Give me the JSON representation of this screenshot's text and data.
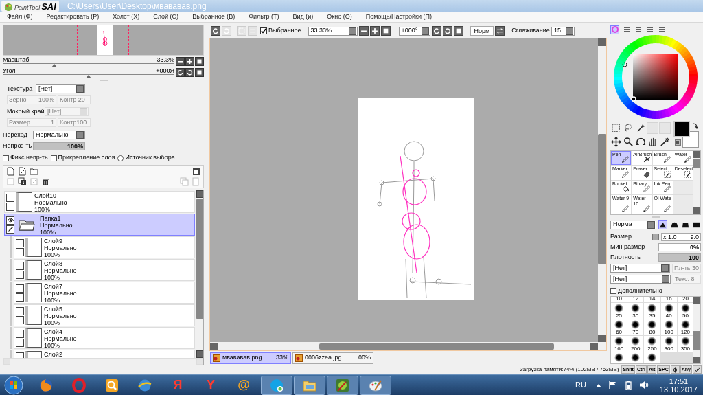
{
  "title_bar": {
    "logo_text": "PaintTool",
    "logo_mark": "SAI",
    "file_path": "C:\\Users\\User\\Desktop\\мвававав.png"
  },
  "menu": [
    "Файл (Ф)",
    "Редактировать (Р)",
    "Холст (Х)",
    "Слой (С)",
    "Выбранное (В)",
    "Фильтр (Т)",
    "Вид (и)",
    "Окно (О)",
    "Помощь/Настройки (П)"
  ],
  "navigator": {
    "zoom": {
      "label": "Масштаб",
      "value": "33.3%",
      "level": 0.3
    },
    "angle": {
      "label": "Угол",
      "value": "+000Я",
      "level": 0.5
    }
  },
  "texture": {
    "label": "Текстура",
    "value": "[Нет]",
    "grain": {
      "label": "Зерно",
      "value": "100%",
      "disabled": true
    },
    "contrast": {
      "value": "Контр 20",
      "disabled": true
    }
  },
  "wet_edge": {
    "label": "Мокрый край",
    "value": "[Нет]",
    "disabled": true,
    "size": {
      "label": "Размер",
      "value": "1",
      "disabled": true
    },
    "contrast": {
      "value": "Контр100",
      "disabled": true
    }
  },
  "blending": {
    "label": "Переход",
    "value": "Нормально"
  },
  "opacity": {
    "label": "Непроз-ть",
    "value": "100%",
    "level": 1
  },
  "layer_options": [
    {
      "kind": "checkbox",
      "label": "Фикс непр-ть",
      "checked": false
    },
    {
      "kind": "checkbox",
      "label": "Прикрепление слоя",
      "checked": false
    },
    {
      "kind": "radio",
      "label": "Источник выбора",
      "checked": false
    }
  ],
  "layers": [
    {
      "kind": "layer",
      "name": "Слой10",
      "mode": "Нормально",
      "opacity": "100%",
      "selected": false,
      "visible": false
    },
    {
      "kind": "folder",
      "name": "Папка1",
      "mode": "Нормально",
      "opacity": "100%",
      "selected": true,
      "visible": true,
      "children": [
        {
          "kind": "layer",
          "name": "Слой9",
          "mode": "Нормально",
          "opacity": "100%",
          "selected": false,
          "visible": false
        },
        {
          "kind": "layer",
          "name": "Слой8",
          "mode": "Нормально",
          "opacity": "100%",
          "selected": false,
          "visible": false
        },
        {
          "kind": "layer",
          "name": "Слой7",
          "mode": "Нормально",
          "opacity": "100%",
          "selected": false,
          "visible": false
        },
        {
          "kind": "layer",
          "name": "Слой5",
          "mode": "Нормально",
          "opacity": "100%",
          "selected": false,
          "visible": false
        },
        {
          "kind": "layer",
          "name": "Слой4",
          "mode": "Нормально",
          "opacity": "100%",
          "selected": false,
          "visible": false
        },
        {
          "kind": "layer",
          "name": "Слой2",
          "selected": false,
          "visible": false
        }
      ]
    }
  ],
  "canvas_toolbar": {
    "selection_only": {
      "label": "Выбранное",
      "checked": true
    },
    "zoom": "33.33%",
    "angle": "+000°",
    "mode_button": "Норм",
    "smoothing": {
      "label": "Сглаживание",
      "value": "15"
    }
  },
  "documents": [
    {
      "name": "мвававав.png",
      "zoom": "33%",
      "selected": true
    },
    {
      "name": "0006zzea.jpg",
      "zoom": "00%",
      "selected": false
    }
  ],
  "status_bar": {
    "memory": "Загрузка памяти:74% (102MB / 763MB)",
    "keys": [
      {
        "kind": "text",
        "label": "Shift"
      },
      {
        "kind": "text",
        "label": "Ctrl"
      },
      {
        "kind": "text",
        "label": "Alt"
      },
      {
        "kind": "text",
        "label": "SPC"
      },
      {
        "kind": "move"
      },
      {
        "kind": "text",
        "label": "Any"
      },
      {
        "kind": "pen"
      }
    ]
  },
  "color_tabs": [
    {
      "kind": "wheel",
      "selected": true
    },
    {
      "kind": "sliders",
      "selected": false
    },
    {
      "kind": "sliders",
      "selected": false
    },
    {
      "kind": "sliders",
      "selected": false
    },
    {
      "kind": "sliders",
      "selected": false
    }
  ],
  "swatches": [
    {
      "kind": "primary",
      "color": "#000000"
    },
    {
      "kind": "secondary",
      "color": "#ffffff"
    }
  ],
  "brush_tools": [
    {
      "kind": "pen",
      "label": "Pen",
      "selected": true
    },
    {
      "kind": "airbrush",
      "label": "AirBrush",
      "selected": false
    },
    {
      "kind": "pen",
      "label": "Brush",
      "selected": false
    },
    {
      "kind": "pen",
      "label": "Water",
      "selected": false
    },
    {
      "kind": "pen",
      "label": "Marker",
      "selected": false
    },
    {
      "kind": "eraser",
      "label": "Eraser",
      "selected": false
    },
    {
      "kind": "select",
      "label": "Select",
      "selected": false
    },
    {
      "kind": "select",
      "label": "Deselect",
      "selected": false
    },
    {
      "kind": "bucket",
      "label": "Bucket",
      "selected": false
    },
    {
      "kind": "pencil",
      "label": "Binary",
      "selected": false
    },
    {
      "kind": "pen",
      "label": "Ink Pen",
      "selected": false
    },
    {
      "kind": "empty"
    },
    {
      "kind": "pen",
      "label": "Water 9",
      "selected": false
    },
    {
      "kind": "pen",
      "label": "Water 10",
      "selected": false
    },
    {
      "kind": "pen",
      "label": "Ol Wate",
      "selected": false
    },
    {
      "kind": "empty"
    }
  ],
  "brush_settings": {
    "mode": "Норма",
    "shapes": [
      {
        "kind": "sharp",
        "selected": true
      },
      {
        "kind": "round",
        "selected": false
      },
      {
        "kind": "flat",
        "selected": false
      },
      {
        "kind": "square",
        "selected": false
      }
    ],
    "size": {
      "label": "Размер",
      "multiplier": "x 1.0",
      "value": "9.0"
    },
    "min_size": {
      "label": "Мин размер",
      "value": "0%",
      "level": 0
    },
    "density": {
      "label": "Плотность",
      "value": "100",
      "level": 1
    },
    "materials": [
      {
        "value": "[Нет]",
        "param": "Пл-ть 30",
        "disabled": true
      },
      {
        "value": "[Нет]",
        "param": "Текс.   8",
        "disabled": true
      }
    ],
    "advanced": {
      "label": "Дополнительно",
      "checked": false
    }
  },
  "brush_sizes": [
    {
      "kind": "label",
      "label": "10"
    },
    {
      "kind": "label",
      "label": "12"
    },
    {
      "kind": "label",
      "label": "14"
    },
    {
      "kind": "label",
      "label": "16"
    },
    {
      "kind": "label",
      "label": "20"
    },
    {
      "kind": "dot",
      "label": "25"
    },
    {
      "kind": "dot",
      "label": "30"
    },
    {
      "kind": "dot",
      "label": "35"
    },
    {
      "kind": "dot",
      "label": "40"
    },
    {
      "kind": "dot",
      "label": "50"
    },
    {
      "kind": "dot",
      "label": "60"
    },
    {
      "kind": "dot",
      "label": "70"
    },
    {
      "kind": "dot",
      "label": "80"
    },
    {
      "kind": "dot",
      "label": "100"
    },
    {
      "kind": "dot",
      "label": "120"
    },
    {
      "kind": "dot",
      "label": "160"
    },
    {
      "kind": "dot",
      "label": "200"
    },
    {
      "kind": "dot",
      "label": "250"
    },
    {
      "kind": "dot",
      "label": "300"
    },
    {
      "kind": "dot",
      "label": "350"
    },
    {
      "kind": "dot"
    },
    {
      "kind": "dot"
    },
    {
      "kind": "dot"
    }
  ],
  "taskbar": {
    "apps": [
      {
        "kind": "firefox",
        "running": false
      },
      {
        "kind": "opera",
        "running": false
      },
      {
        "kind": "search",
        "running": false
      },
      {
        "kind": "ie",
        "running": false
      },
      {
        "kind": "yandex",
        "glyph": "Я",
        "running": false
      },
      {
        "kind": "ybrowser",
        "glyph": "Y",
        "running": false
      },
      {
        "kind": "mail",
        "glyph": "@",
        "running": false
      },
      {
        "kind": "skype",
        "running": true
      },
      {
        "kind": "explorer",
        "running": true
      },
      {
        "kind": "sai",
        "running": true
      },
      {
        "kind": "paint",
        "running": true
      }
    ],
    "language": "RU",
    "time": "17:51",
    "date": "13.10.2017"
  }
}
